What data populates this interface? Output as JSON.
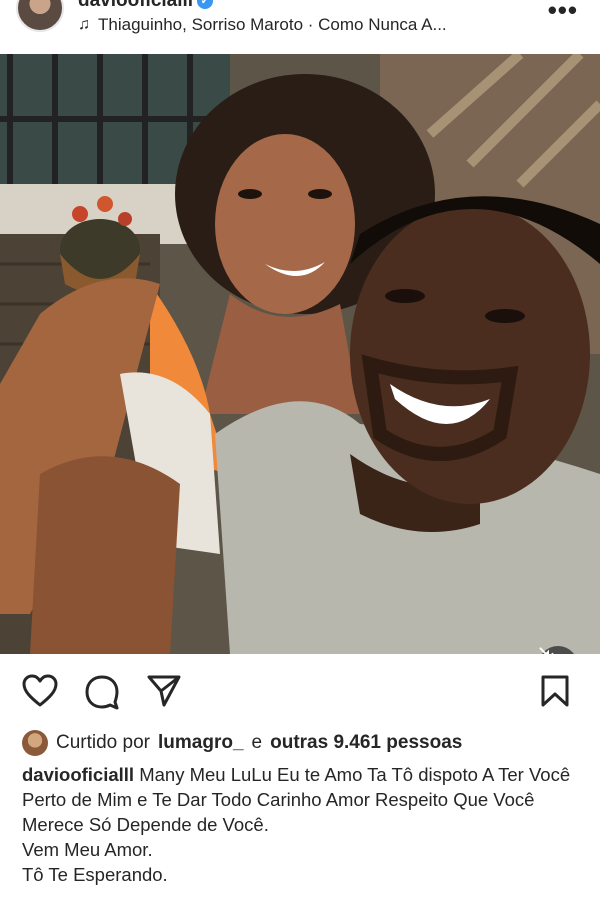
{
  "header": {
    "username": "daviooficialll",
    "music": "Thiaguinho, Sorriso Maroto · Como Nunca A...",
    "icons": {
      "avatar": "profile-avatar",
      "music": "music-note-icon",
      "more": "more-options-icon",
      "verified": "verified-badge-icon"
    }
  },
  "photo": {
    "icons": {
      "mute": "speaker-muted-icon"
    }
  },
  "actions": {
    "icons": [
      "heart-icon",
      "comment-icon",
      "share-icon",
      "bookmark-icon"
    ]
  },
  "likes": {
    "prefix": "Curtido por",
    "user": "lumagro_",
    "connector": "e",
    "others": "outras 9.461 pessoas"
  },
  "caption": {
    "author": "daviooficialll",
    "text": "Many Meu LuLu Eu te Amo Ta Tô dispoto A Ter Você Perto de Mim e Te Dar Todo Carinho Amor Respeito Que Você Merece Só Depende de Você.",
    "line2": "Vem Meu Amor.",
    "line3": "Tô Te Esperando."
  }
}
